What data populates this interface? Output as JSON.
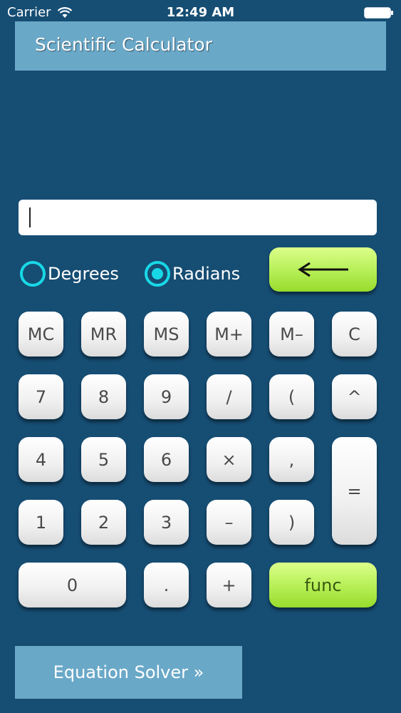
{
  "status_bar": {
    "carrier": "Carrier",
    "time": "12:49 AM"
  },
  "header": {
    "title": "Scientific Calculator"
  },
  "display": {
    "value": ""
  },
  "angle_mode": {
    "options": [
      {
        "label": "Degrees",
        "selected": false
      },
      {
        "label": "Radians",
        "selected": true
      }
    ]
  },
  "keys": {
    "mc": "MC",
    "mr": "MR",
    "ms": "MS",
    "m_plus": "M+",
    "m_minus": "M–",
    "clear": "C",
    "seven": "7",
    "eight": "8",
    "nine": "9",
    "divide": "/",
    "open_paren": "(",
    "power": "^",
    "four": "4",
    "five": "5",
    "six": "6",
    "multiply": "×",
    "comma": ",",
    "equals": "=",
    "one": "1",
    "two": "2",
    "three": "3",
    "minus": "–",
    "close_paren": ")",
    "zero": "0",
    "decimal": ".",
    "plus": "+",
    "func": "func"
  },
  "footer": {
    "equation_solver": "Equation Solver »"
  },
  "colors": {
    "background": "#164d73",
    "bar": "#6aa8c8",
    "radio_accent": "#18d8e6",
    "green_key": "#b8f05a"
  }
}
